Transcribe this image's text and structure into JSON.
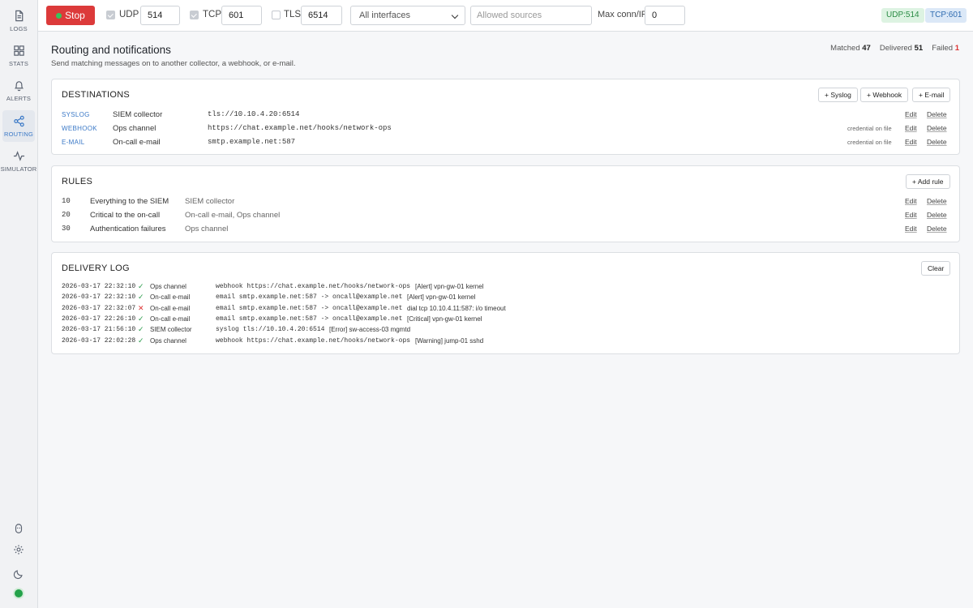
{
  "sidebar": {
    "items": [
      {
        "label": "LOGS",
        "icon": "file-icon"
      },
      {
        "label": "STATS",
        "icon": "grid-icon"
      },
      {
        "label": "ALERTS",
        "icon": "bell-icon"
      },
      {
        "label": "ROUTING",
        "icon": "share-icon",
        "active": true
      },
      {
        "label": "SIMULATOR",
        "icon": "pulse-icon"
      }
    ],
    "bottom_icons": [
      "shield-icon",
      "gear-icon",
      "moon-icon"
    ],
    "status_color": "#24a24a"
  },
  "toolbar": {
    "stop_label": "Stop",
    "udp_label": "UDP",
    "udp_port": "514",
    "udp_checked": true,
    "tcp_label": "TCP",
    "tcp_port": "601",
    "tcp_checked": true,
    "tls_label": "TLS",
    "tls_port": "6514",
    "tls_checked": false,
    "interface": "All interfaces",
    "sources_placeholder": "Allowed sources",
    "maxconn_label": "Max conn/IP",
    "maxconn_value": "0",
    "udp_badge": "UDP:514",
    "tcp_badge": "TCP:601"
  },
  "page": {
    "title": "Routing and notifications",
    "subtitle": "Send matching messages on to another collector, a webhook, or e-mail.",
    "stats": {
      "matched_label": "Matched",
      "matched": "47",
      "delivered_label": "Delivered",
      "delivered": "51",
      "failed_label": "Failed",
      "failed": "1"
    }
  },
  "destinations": {
    "title": "DESTINATIONS",
    "add_syslog": "+ Syslog",
    "add_webhook": "+ Webhook",
    "add_email": "+ E-mail",
    "edit": "Edit",
    "delete": "Delete",
    "items": [
      {
        "kind": "SYSLOG",
        "name": "SIEM collector",
        "target": "tls://10.10.4.20:6514",
        "note": ""
      },
      {
        "kind": "WEBHOOK",
        "name": "Ops channel",
        "target": "https://chat.example.net/hooks/network-ops",
        "note": "credential on file"
      },
      {
        "kind": "E-MAIL",
        "name": "On-call e-mail",
        "target": "smtp.example.net:587",
        "note": "credential on file"
      }
    ]
  },
  "rules": {
    "title": "RULES",
    "add_rule": "+ Add rule",
    "edit": "Edit",
    "delete": "Delete",
    "items": [
      {
        "priority": "10",
        "name": "Everything to the SIEM",
        "destinations": "SIEM collector"
      },
      {
        "priority": "20",
        "name": "Critical to the on-call",
        "destinations": "On-call e-mail, Ops channel"
      },
      {
        "priority": "30",
        "name": "Authentication failures",
        "destinations": "Ops channel"
      }
    ]
  },
  "delivery_log": {
    "title": "DELIVERY LOG",
    "clear": "Clear",
    "entries": [
      {
        "time": "2026-03-17 22:32:10",
        "ok": true,
        "dest": "Ops channel",
        "target": "webhook https://chat.example.net/hooks/network-ops",
        "message": "[Alert] vpn-gw-01 kernel"
      },
      {
        "time": "2026-03-17 22:32:10",
        "ok": true,
        "dest": "On-call e-mail",
        "target": "email smtp.example.net:587 -> oncall@example.net",
        "message": "[Alert] vpn-gw-01 kernel"
      },
      {
        "time": "2026-03-17 22:32:07",
        "ok": false,
        "dest": "On-call e-mail",
        "target": "email smtp.example.net:587 -> oncall@example.net",
        "message": "dial tcp 10.10.4.11:587: i/o timeout"
      },
      {
        "time": "2026-03-17 22:26:10",
        "ok": true,
        "dest": "On-call e-mail",
        "target": "email smtp.example.net:587 -> oncall@example.net",
        "message": "[Critical] vpn-gw-01 kernel"
      },
      {
        "time": "2026-03-17 21:56:10",
        "ok": true,
        "dest": "SIEM collector",
        "target": "syslog tls://10.10.4.20:6514",
        "message": "[Error] sw-access-03 mgmtd"
      },
      {
        "time": "2026-03-17 22:02:28",
        "ok": true,
        "dest": "Ops channel",
        "target": "webhook https://chat.example.net/hooks/network-ops",
        "message": "[Warning] jump-01 sshd"
      }
    ],
    "ok_glyph": "✓",
    "fail_glyph": "✕"
  }
}
